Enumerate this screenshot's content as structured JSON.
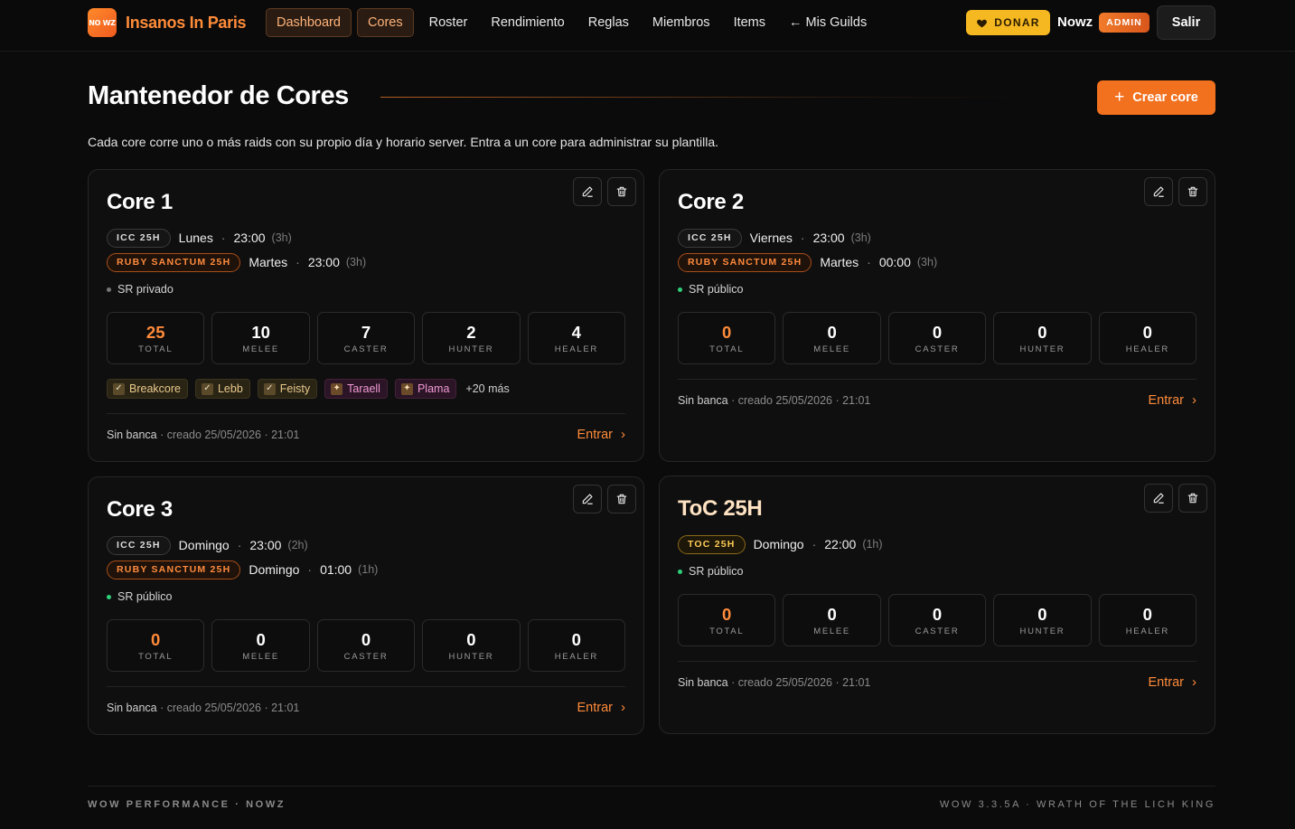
{
  "brand": {
    "logo_text": "NO WZ",
    "name": "Insanos In Paris"
  },
  "nav": {
    "items": [
      {
        "label": "Dashboard"
      },
      {
        "label": "Cores"
      },
      {
        "label": "Roster"
      },
      {
        "label": "Rendimiento"
      },
      {
        "label": "Reglas"
      },
      {
        "label": "Miembros"
      },
      {
        "label": "Items"
      },
      {
        "label": "← Mis Guilds"
      }
    ]
  },
  "header": {
    "donate_label": "DONAR",
    "user_name": "Nowz",
    "role_badge": "ADMIN",
    "logout_label": "Salir"
  },
  "page": {
    "title": "Mantenedor de Cores",
    "create_label": "Crear core",
    "subtitle": "Cada core corre uno o más raids con su propio día y horario server. Entra a un core para administrar su plantilla."
  },
  "cores": [
    {
      "name": "Core 1",
      "raids": [
        {
          "tag": "ICC 25H",
          "day": "Lunes",
          "time": "23:00",
          "duration": "(3h)"
        },
        {
          "tag": "RUBY SANCTUM 25H",
          "day": "Martes",
          "time": "23:00",
          "duration": "(3h)"
        }
      ],
      "sr_label": "SR privado",
      "stats": [
        {
          "value": "25",
          "label": "TOTAL"
        },
        {
          "value": "10",
          "label": "MELEE"
        },
        {
          "value": "7",
          "label": "CASTER"
        },
        {
          "value": "2",
          "label": "HUNTER"
        },
        {
          "value": "4",
          "label": "HEALER"
        }
      ],
      "members": [
        {
          "name": "Breakcore"
        },
        {
          "name": "Lebb"
        },
        {
          "name": "Feisty"
        },
        {
          "name": "Taraell"
        },
        {
          "name": "Plama"
        }
      ],
      "more_label": "+20 más",
      "footer_bank": "Sin banca",
      "footer_created": "· creado 25/05/2026 · 21:01",
      "enter_label": "Entrar"
    },
    {
      "name": "Core 2",
      "raids": [
        {
          "tag": "ICC 25H",
          "day": "Viernes",
          "time": "23:00",
          "duration": "(3h)"
        },
        {
          "tag": "RUBY SANCTUM 25H",
          "day": "Martes",
          "time": "00:00",
          "duration": "(3h)"
        }
      ],
      "sr_label": "SR público",
      "stats": [
        {
          "value": "0",
          "label": "TOTAL"
        },
        {
          "value": "0",
          "label": "MELEE"
        },
        {
          "value": "0",
          "label": "CASTER"
        },
        {
          "value": "0",
          "label": "HUNTER"
        },
        {
          "value": "0",
          "label": "HEALER"
        }
      ],
      "footer_bank": "Sin banca",
      "footer_created": "· creado 25/05/2026 · 21:01",
      "enter_label": "Entrar"
    },
    {
      "name": "Core 3",
      "raids": [
        {
          "tag": "ICC 25H",
          "day": "Domingo",
          "time": "23:00",
          "duration": "(2h)"
        },
        {
          "tag": "RUBY SANCTUM 25H",
          "day": "Domingo",
          "time": "01:00",
          "duration": "(1h)"
        }
      ],
      "sr_label": "SR público",
      "stats": [
        {
          "value": "0",
          "label": "TOTAL"
        },
        {
          "value": "0",
          "label": "MELEE"
        },
        {
          "value": "0",
          "label": "CASTER"
        },
        {
          "value": "0",
          "label": "HUNTER"
        },
        {
          "value": "0",
          "label": "HEALER"
        }
      ],
      "footer_bank": "Sin banca",
      "footer_created": "· creado 25/05/2026 · 21:01",
      "enter_label": "Entrar"
    },
    {
      "name": "ToC 25H",
      "raids": [
        {
          "tag": "TOC 25H",
          "day": "Domingo",
          "time": "22:00",
          "duration": "(1h)"
        }
      ],
      "sr_label": "SR público",
      "stats": [
        {
          "value": "0",
          "label": "TOTAL"
        },
        {
          "value": "0",
          "label": "MELEE"
        },
        {
          "value": "0",
          "label": "CASTER"
        },
        {
          "value": "0",
          "label": "HUNTER"
        },
        {
          "value": "0",
          "label": "HEALER"
        }
      ],
      "footer_bank": "Sin banca",
      "footer_created": "· creado 25/05/2026 · 21:01",
      "enter_label": "Entrar"
    }
  ],
  "footer": {
    "left": "WOW PERFORMANCE · NOWZ",
    "right": "WOW 3.3.5A · WRATH OF THE LICH KING"
  },
  "colors": {
    "accent": "#f2711f",
    "accent_text": "#ff8b3a",
    "donate": "#f5b820",
    "sr_public": "#2fd07a",
    "background": "#0b0b0b"
  },
  "icons": {
    "donate": "heart-icon",
    "create": "plus-icon",
    "edit": "pencil-icon",
    "delete": "trash-icon",
    "enter": "chevron-right-icon"
  }
}
